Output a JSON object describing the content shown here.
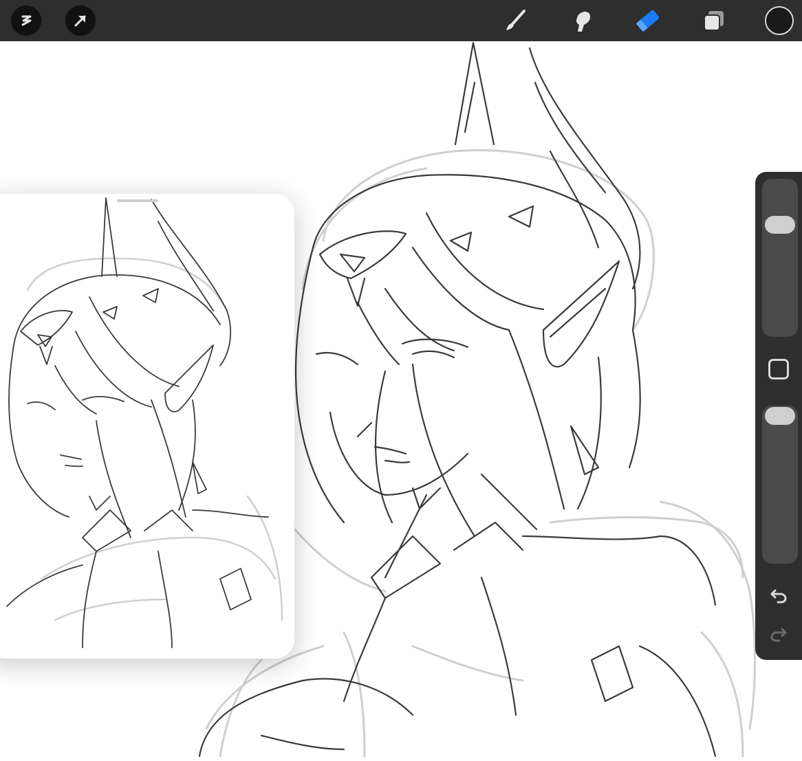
{
  "toolbar": {
    "left": [
      {
        "name": "gallery-s-icon"
      },
      {
        "name": "transform-arrow-icon"
      }
    ],
    "right": [
      {
        "name": "brush-icon"
      },
      {
        "name": "smudge-icon"
      },
      {
        "name": "eraser-icon",
        "active": true
      },
      {
        "name": "layers-icon"
      },
      {
        "name": "color-well"
      }
    ],
    "background_color": "#2e2e2e",
    "active_color": "#1a7cf5",
    "icon_color": "#e6e6e6",
    "current_color": "#1a1a1a"
  },
  "sidebar": {
    "brush_size_level": 0.74,
    "brush_opacity_level": 1.0,
    "icons": [
      "modify-square-icon",
      "undo-icon",
      "redo-icon"
    ]
  },
  "canvas": {
    "background_color": "#ffffff",
    "stroke_color": "#3a3a3a",
    "sketch_stroke_color": "#c8c8c8"
  },
  "reference_panel": {
    "visible": true
  }
}
